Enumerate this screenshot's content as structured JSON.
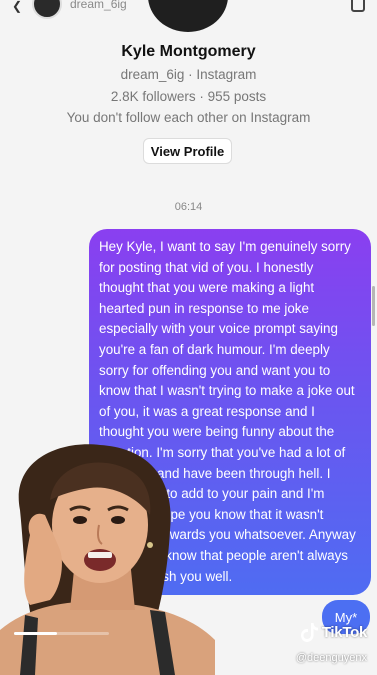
{
  "header": {
    "username": "dream_6ig",
    "back_icon": "chevron-left-icon",
    "right_icon": "info-icon"
  },
  "profile": {
    "name": "Kyle Montgomery",
    "handle_line": "dream_6ig · Instagram",
    "stats_line": "2.8K followers · 955 posts",
    "follow_status": "You don't follow each other on Instagram",
    "view_profile_label": "View Profile"
  },
  "thread": {
    "timestamp": "06:14",
    "messages": [
      {
        "text": "Hey Kyle, I want to say I'm genuinely sorry for posting that vid of you. I honestly thought that you were making a light hearted pun in response to me joke especially with your voice prompt saying you're a fan of dark humour. I'm deeply sorry for offending you and want you to know that I wasn't trying to make a joke out of you, it was a great response and I thought you were being funny about the situation. I'm sorry that you've had a lot of prejudice and have been through hell. I didn't want to add to your pain and I'm sincerely hope you know that it wasn't malicious towards you whatsoever. Anyway I hope you know that people aren't always shit and wish you well."
      },
      {
        "text": "My*"
      }
    ]
  },
  "video": {
    "progress": 0.45,
    "watermark_brand": "TikTok",
    "watermark_handle": "@deenguyenx"
  },
  "colors": {
    "bubble_top": "#8a3ff0",
    "bubble_bottom": "#4f6cf2",
    "background": "#f4f4f4"
  }
}
